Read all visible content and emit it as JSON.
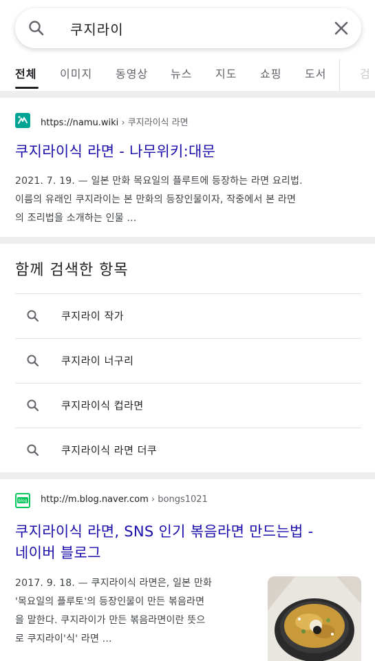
{
  "search": {
    "query": "쿠지라이"
  },
  "tabs": [
    "전체",
    "이미지",
    "동영상",
    "뉴스",
    "지도",
    "쇼핑",
    "도서",
    "검"
  ],
  "results": [
    {
      "url": "https://namu.wiki",
      "breadcrumb": "› 쿠지라이식 라면",
      "title": "쿠지라이식 라면 - 나무위키:대문",
      "snippet_lines": [
        "2021. 7. 19. — 일본 만화 목요일의 플루트에 등장하는 라면 요리법.",
        "이름의 유래인 쿠지라이는 본 만화의 등장인물이자, 작중에서 본 라면",
        "의 조리법을 소개하는 인물 ..."
      ]
    },
    {
      "url": "http://m.blog.naver.com",
      "breadcrumb": "› bongs1021",
      "title_lines": [
        "쿠지라이식 라면, SNS 인기 볶음라면 만드는법 -",
        "네이버 블로그"
      ],
      "snippet_lines": [
        "2017. 9. 18. — 쿠지라이식 라면은, 일본 만화",
        "'목요일의 플루토'의 등장인물이 만든 볶음라면",
        "을 말한다. 쿠지라이가 만든 볶음라면이란 뜻으",
        "로 쿠지라이'식' 라면 ..."
      ]
    }
  ],
  "related": {
    "title": "함께 검색한 항목",
    "items": [
      "쿠지라이 작가",
      "쿠지라이 너구리",
      "쿠지라이식 컵라면",
      "쿠지라이식 라면 더쿠"
    ]
  },
  "icons": {
    "namu_favicon": "namu-wiki-icon",
    "naver_favicon": "naver-blog-icon"
  },
  "colors": {
    "link": "#1a0dab",
    "namu_green": "#00a495",
    "naver_green": "#03c75a"
  }
}
